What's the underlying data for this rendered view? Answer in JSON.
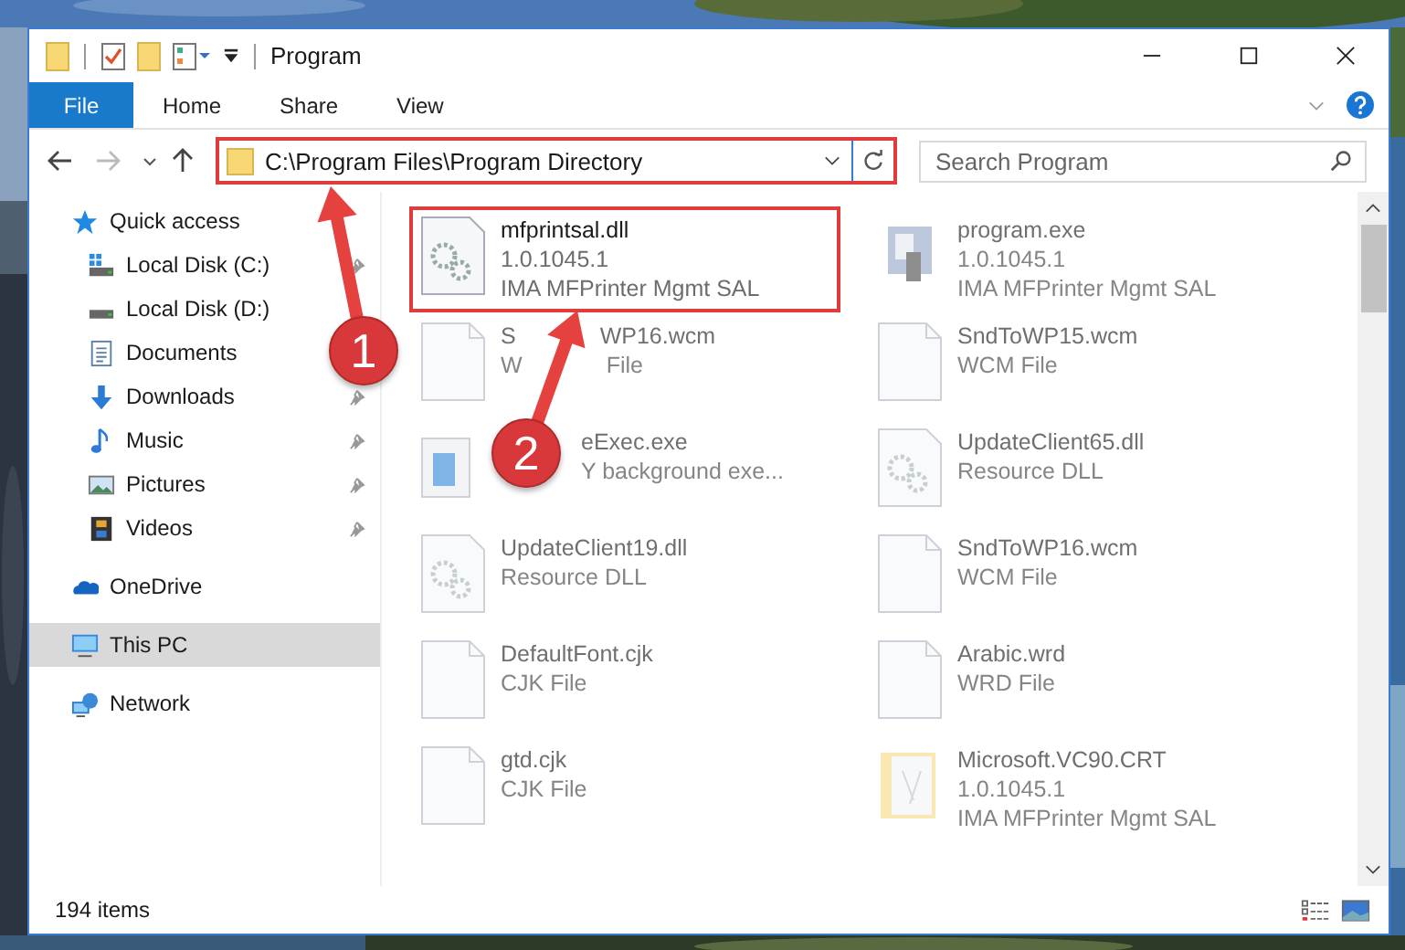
{
  "window": {
    "title": "Program"
  },
  "ribbon_tabs": [
    {
      "label": "File",
      "selected": true
    },
    {
      "label": "Home",
      "selected": false
    },
    {
      "label": "Share",
      "selected": false
    },
    {
      "label": "View",
      "selected": false
    }
  ],
  "address": {
    "path": "C:\\Program Files\\Program Directory",
    "highlighted": true
  },
  "search": {
    "placeholder": "Search Program"
  },
  "sidebar": {
    "items": [
      {
        "label": "Quick access",
        "kind": "star",
        "selected": false,
        "children": [
          {
            "label": "Local Disk (C:)",
            "kind": "system-drive",
            "pinned": true,
            "selected": false
          },
          {
            "label": "Local Disk (D:)",
            "kind": "drive",
            "selected": false
          },
          {
            "label": "Documents",
            "kind": "document",
            "selected": false
          },
          {
            "label": "Downloads",
            "kind": "download",
            "pinned": true,
            "selected": false
          },
          {
            "label": "Music",
            "kind": "music",
            "pinned": true,
            "selected": false
          },
          {
            "label": "Pictures",
            "kind": "pictures",
            "pinned": true,
            "selected": false
          },
          {
            "label": "Videos",
            "kind": "videos",
            "pinned": true,
            "selected": false
          }
        ]
      },
      {
        "label": "OneDrive",
        "kind": "cloud",
        "selected": false
      },
      {
        "label": "This PC",
        "kind": "computer",
        "selected": true
      },
      {
        "label": "Network",
        "kind": "network",
        "selected": false
      }
    ]
  },
  "files": [
    {
      "name": [
        "mfprintsal.dll"
      ],
      "lines": [
        [
          "1.0.1045.1"
        ],
        [
          "IMA MFPrinter Mgmt SAL"
        ]
      ],
      "kind": "gears",
      "dimmed": false,
      "highlighted": true
    },
    {
      "name": [
        "program.exe"
      ],
      "lines": [
        [
          "1.0.1045.1"
        ],
        [
          "IMA MFPrinter Mgmt SAL"
        ]
      ],
      "kind": "app",
      "dimmed": true,
      "highlighted": false
    },
    {
      "name": [
        "S",
        "WP16.wcm"
      ],
      "lines": [
        [
          "W",
          "File"
        ]
      ],
      "kind": "blank",
      "dimmed": true,
      "highlighted": false
    },
    {
      "name": [
        "SndToWP15.wcm"
      ],
      "lines": [
        [
          "WCM File"
        ]
      ],
      "kind": "blank",
      "dimmed": true,
      "highlighted": false
    },
    {
      "name": [
        "eExec.exe"
      ],
      "lines": [
        [
          "Y background exe..."
        ]
      ],
      "kind": "window",
      "dimmed": true,
      "highlighted": false,
      "covered_start": true
    },
    {
      "name": [
        "UpdateClient65.dll"
      ],
      "lines": [
        [
          "Resource DLL"
        ]
      ],
      "kind": "gears",
      "dimmed": true,
      "highlighted": false
    },
    {
      "name": [
        "UpdateClient19.dll"
      ],
      "lines": [
        [
          "Resource DLL"
        ]
      ],
      "kind": "gears",
      "dimmed": true,
      "highlighted": false
    },
    {
      "name": [
        "SndToWP16.wcm"
      ],
      "lines": [
        [
          "WCM File"
        ]
      ],
      "kind": "blank",
      "dimmed": true,
      "highlighted": false
    },
    {
      "name": [
        "DefaultFont.cjk"
      ],
      "lines": [
        [
          "CJK File"
        ]
      ],
      "kind": "blank",
      "dimmed": true,
      "highlighted": false
    },
    {
      "name": [
        "Arabic.wrd"
      ],
      "lines": [
        [
          "WRD File"
        ]
      ],
      "kind": "blank",
      "dimmed": true,
      "highlighted": false
    },
    {
      "name": [
        "gtd.cjk"
      ],
      "lines": [
        [
          "CJK File"
        ]
      ],
      "kind": "blank",
      "dimmed": true,
      "highlighted": false
    },
    {
      "name": [
        "Microsoft.VC90.CRT"
      ],
      "lines": [
        [
          "1.0.1045.1"
        ],
        [
          "IMA MFPrinter Mgmt SAL"
        ]
      ],
      "kind": "folder",
      "dimmed": true,
      "highlighted": false
    }
  ],
  "status_bar": {
    "count": "194 items"
  },
  "annotations": [
    {
      "label": "1"
    },
    {
      "label": "2"
    }
  ]
}
